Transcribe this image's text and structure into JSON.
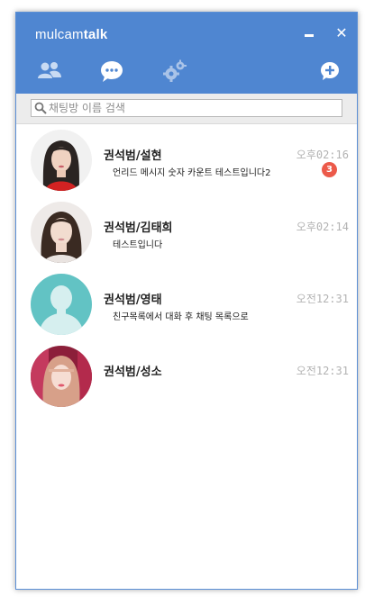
{
  "app": {
    "brand_light": "mulcam",
    "brand_bold": "talk"
  },
  "window_controls": {
    "minimize": "minimize",
    "close": "✕"
  },
  "toolbar": {
    "friends_icon": "people-icon",
    "chat_icon": "chat-bubble-icon",
    "settings_icon": "gear-icon",
    "new_chat_icon": "new-chat-icon"
  },
  "search": {
    "placeholder": "채팅방 이름 검색",
    "value": ""
  },
  "chats": [
    {
      "name": "권석범/설현",
      "preview": "언리드 메시지 숫자 카운트 테스트입니다2",
      "time": "오후02:16",
      "unread": "3"
    },
    {
      "name": "권석범/김태희",
      "preview": "테스트입니다",
      "time": "오후02:14"
    },
    {
      "name": "권석범/영태",
      "preview": "친구목록에서 대화 후 채팅 목록으로",
      "time": "오전12:31"
    },
    {
      "name": "권석범/성소",
      "preview": "",
      "time": "오전12:31"
    }
  ],
  "colors": {
    "header": "#4f86d1",
    "badge": "#ec5a4a",
    "time": "#b3b3b3",
    "default_avatar": "#62c3c4"
  }
}
